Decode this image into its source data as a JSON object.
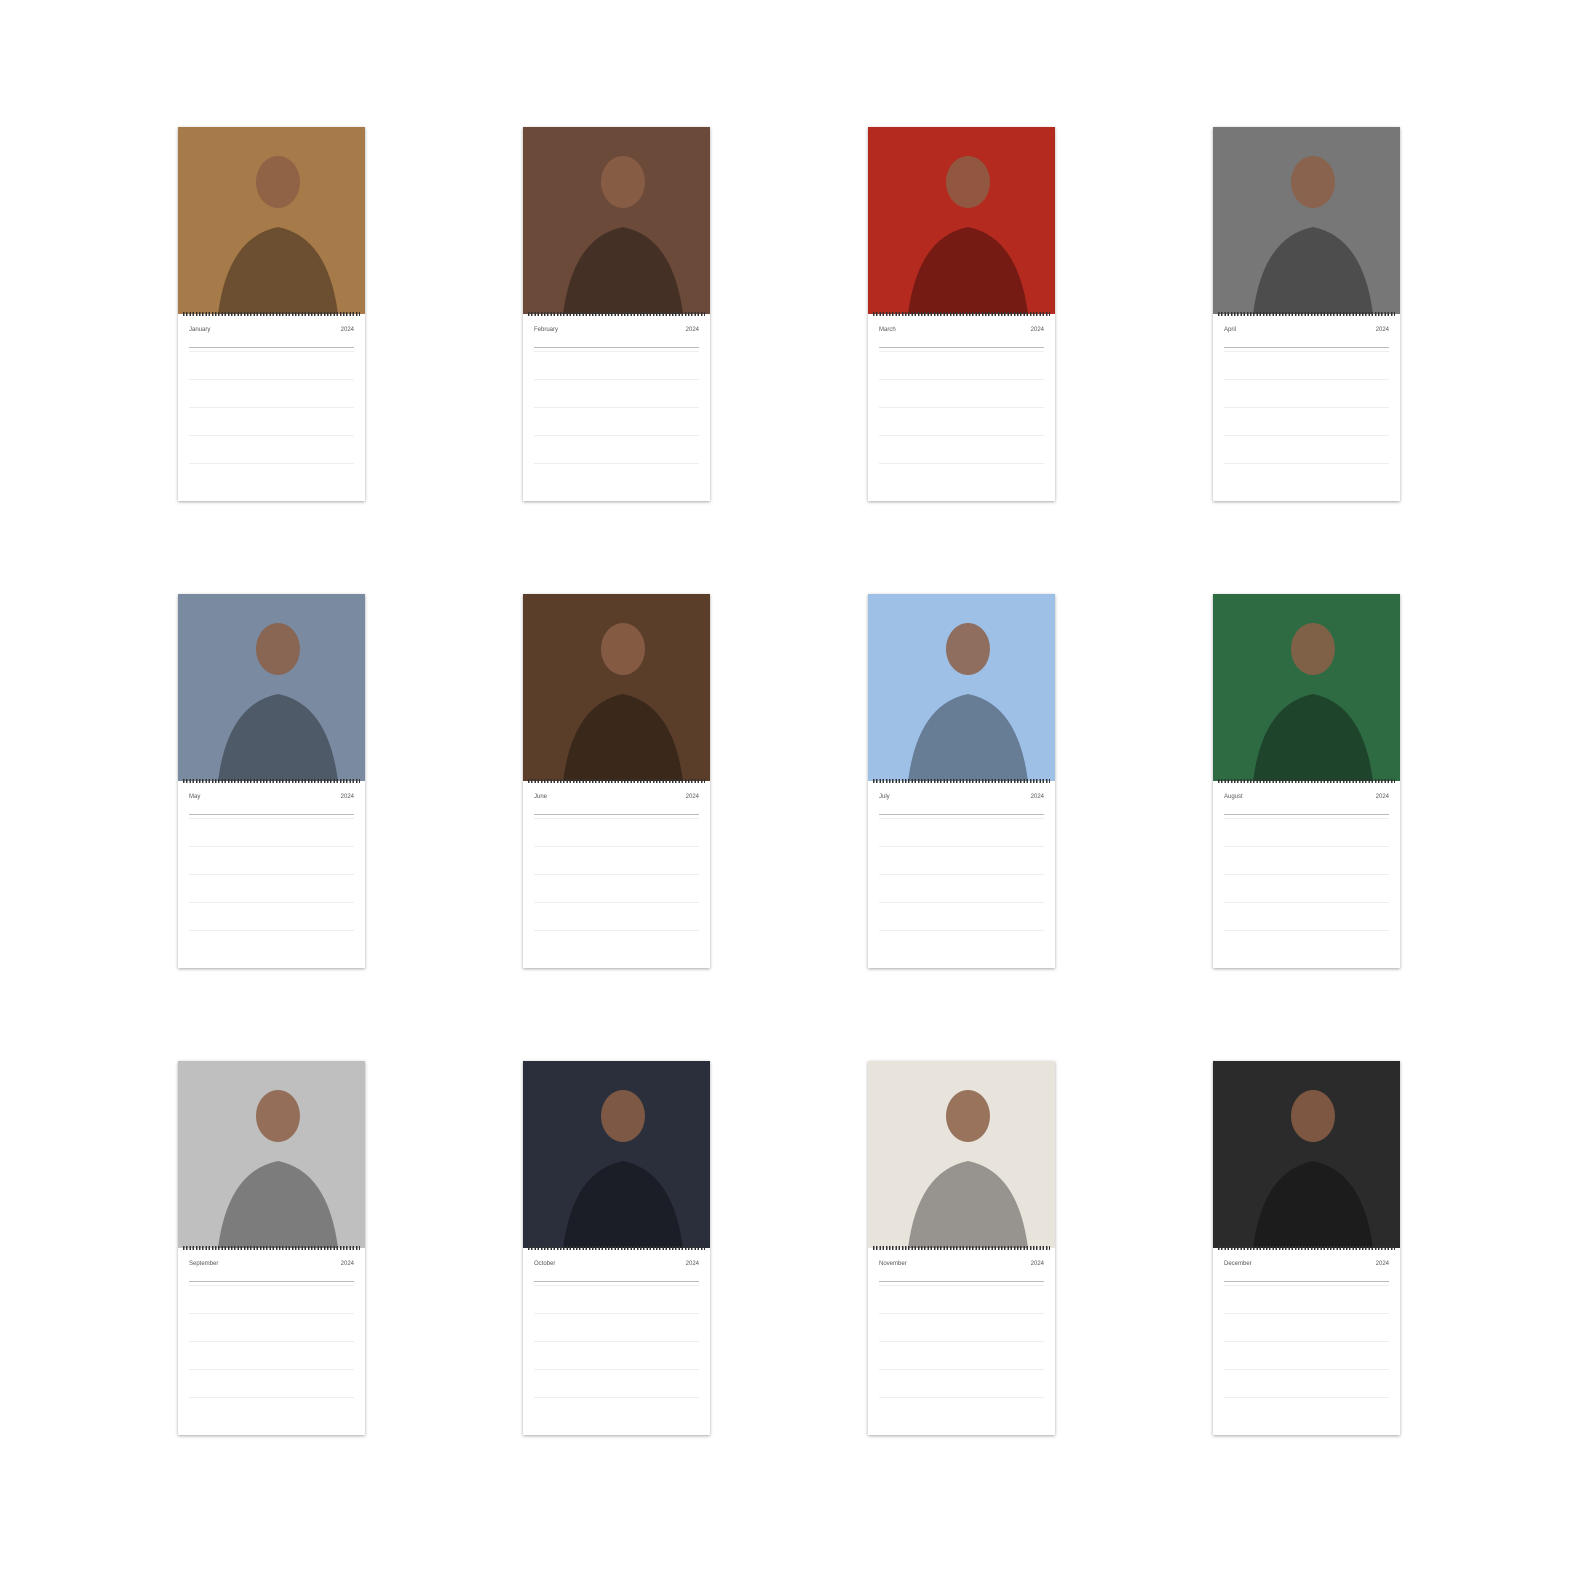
{
  "calendar": {
    "year": "2024",
    "months": [
      {
        "name": "January",
        "photo": "portrait-sitting-warm-room",
        "tone": "#a77a4a"
      },
      {
        "name": "February",
        "photo": "portrait-american-flag",
        "tone": "#6b4a3a"
      },
      {
        "name": "March",
        "photo": "portrait-yellow-polo-red-backdrop",
        "tone": "#b52a1f"
      },
      {
        "name": "April",
        "photo": "black-white-street-photo",
        "tone": "#777777"
      },
      {
        "name": "May",
        "photo": "portrait-with-dog-truck",
        "tone": "#7a8aa0"
      },
      {
        "name": "June",
        "photo": "portrait-hand-on-face",
        "tone": "#5a3e2a"
      },
      {
        "name": "July",
        "photo": "portrait-white-tee-blue-sky",
        "tone": "#9fc0e6"
      },
      {
        "name": "August",
        "photo": "portrait-green-shirt-smile",
        "tone": "#2e6b43"
      },
      {
        "name": "September",
        "photo": "black-white-reaching-hand",
        "tone": "#bfbfbf"
      },
      {
        "name": "October",
        "photo": "portrait-black-turtleneck",
        "tone": "#2a2f3b"
      },
      {
        "name": "November",
        "photo": "portrait-smiling-chain",
        "tone": "#e8e4dc"
      },
      {
        "name": "December",
        "photo": "portrait-vest-white-shirt",
        "tone": "#2b2b2b"
      }
    ]
  }
}
